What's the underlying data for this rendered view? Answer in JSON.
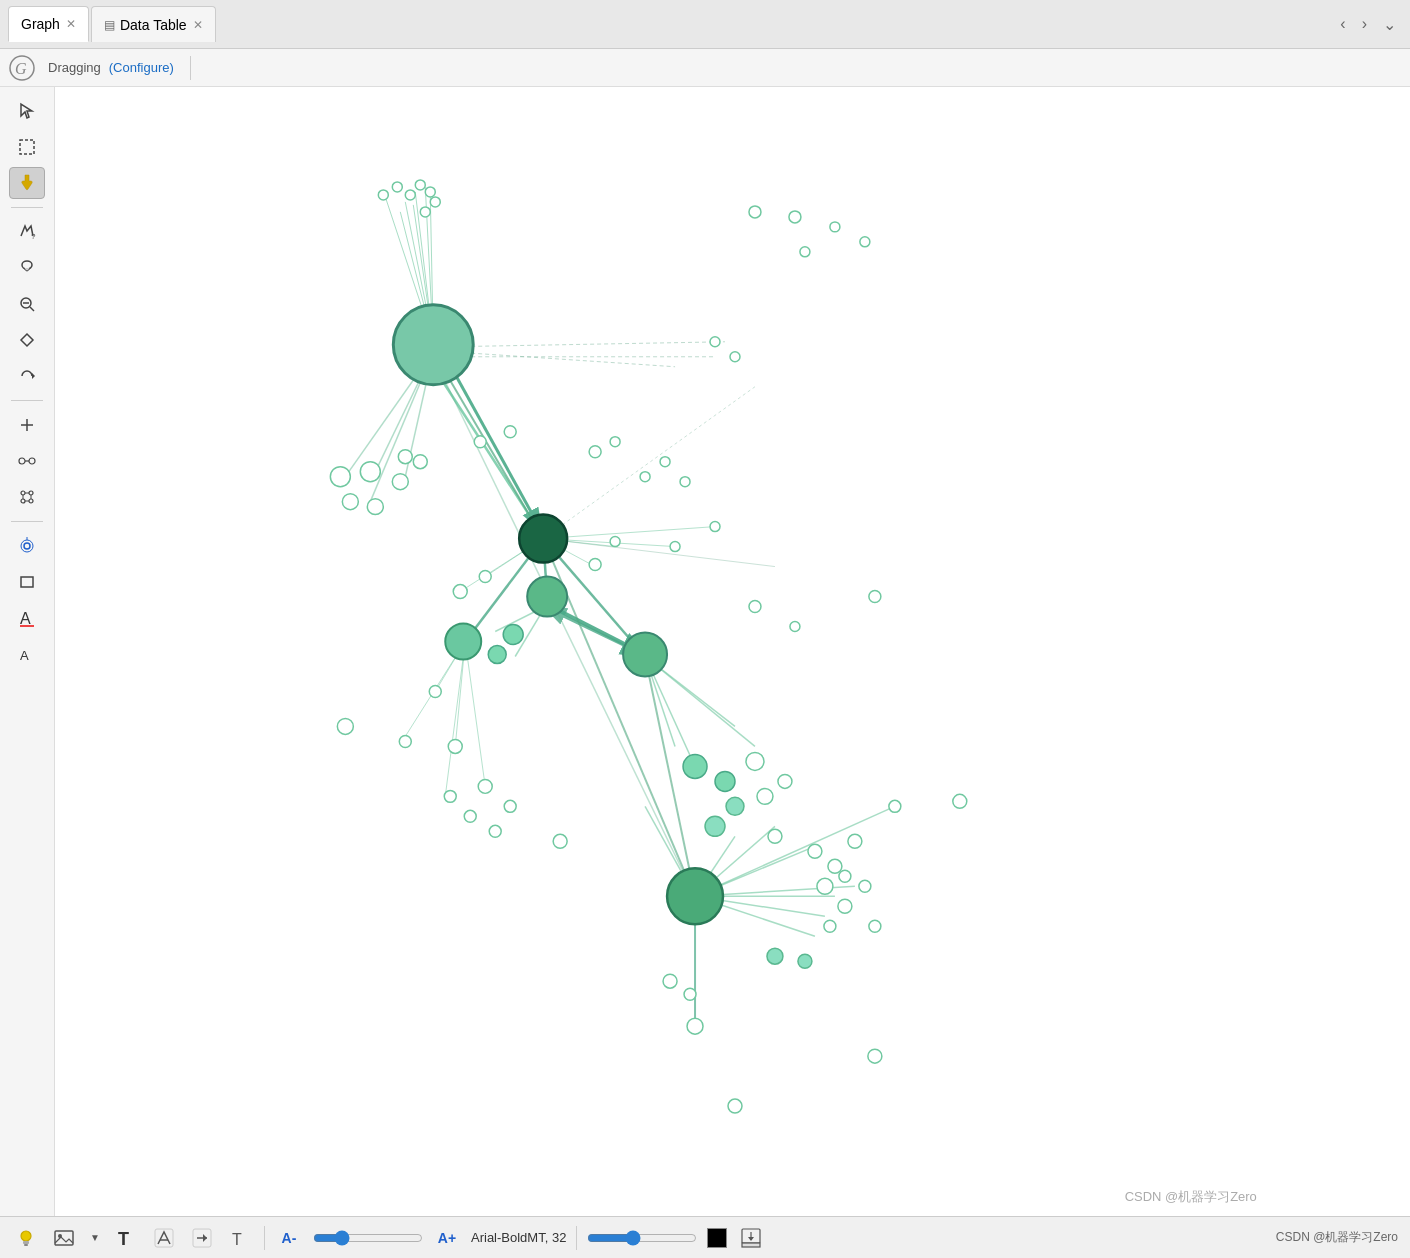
{
  "tabs": [
    {
      "id": "graph",
      "label": "Graph",
      "active": true,
      "icon": null
    },
    {
      "id": "datatable",
      "label": "Data Table",
      "active": false,
      "icon": "table"
    }
  ],
  "toolbar": {
    "status": "Dragging",
    "configure_label": "(Configure)"
  },
  "tools": [
    {
      "id": "select",
      "icon": "↖",
      "label": "Select Tool",
      "active": false
    },
    {
      "id": "marquee",
      "icon": "⬚",
      "label": "Marquee Select",
      "active": false
    },
    {
      "id": "drag",
      "icon": "✋",
      "label": "Drag Tool",
      "active": true
    },
    {
      "id": "annotate",
      "icon": "↗?",
      "label": "Annotate Tool",
      "active": false
    },
    {
      "id": "paint",
      "icon": "🖌",
      "label": "Paint Tool",
      "active": false
    },
    {
      "id": "zoom-out",
      "icon": "⊖",
      "label": "Zoom Out",
      "active": false
    },
    {
      "id": "fill",
      "icon": "◇",
      "label": "Fill Tool",
      "active": false
    },
    {
      "id": "rotate",
      "icon": "↺",
      "label": "Rotate",
      "active": false
    },
    {
      "id": "add-node",
      "icon": "✛",
      "label": "Add Node",
      "active": false
    },
    {
      "id": "add-edge",
      "icon": "⎋",
      "label": "Add Edge",
      "active": false
    },
    {
      "id": "group",
      "icon": "⁙",
      "label": "Group",
      "active": false
    },
    {
      "id": "layout",
      "icon": "⊕",
      "label": "Layout",
      "active": false
    },
    {
      "id": "rect",
      "icon": "▢",
      "label": "Rectangle",
      "active": false
    },
    {
      "id": "text-large",
      "icon": "A",
      "label": "Text Large",
      "active": false
    },
    {
      "id": "text-small",
      "icon": "a",
      "label": "Text Small",
      "active": false
    }
  ],
  "status_bar": {
    "font_name": "Arial-BoldMT",
    "font_size": "32",
    "font_label": "Arial-BoldMT, 32"
  },
  "watermark": "CSDN @机器学习Zero"
}
